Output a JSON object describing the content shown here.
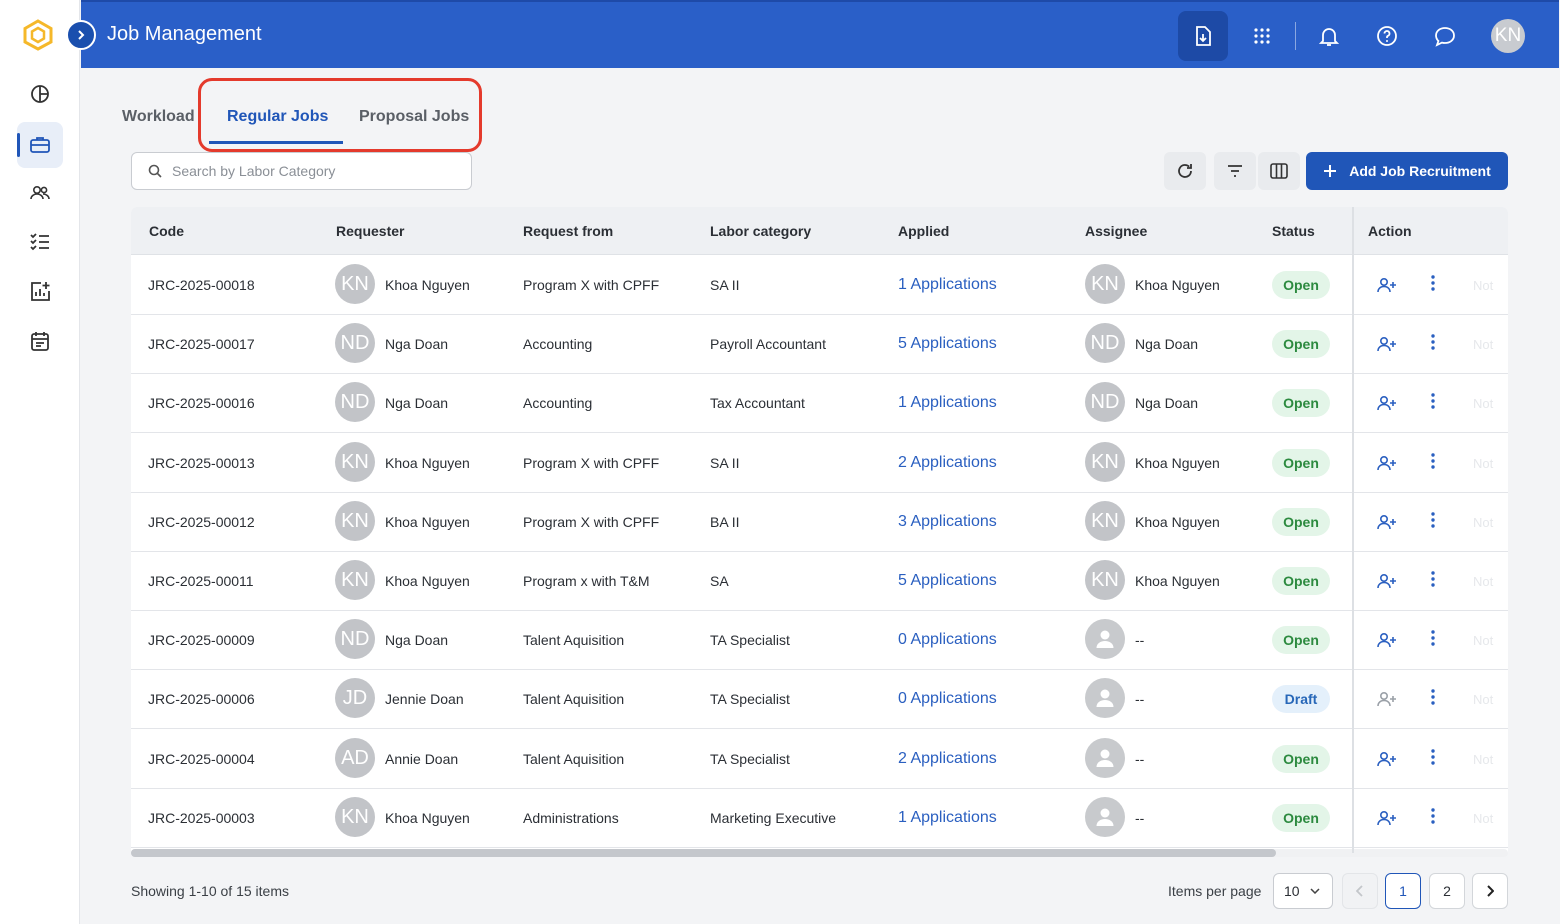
{
  "app": {
    "title": "Job Management",
    "user_initials": "KN"
  },
  "header_icons": [
    "download-doc-icon",
    "apps-grid-icon",
    "bell-icon",
    "help-icon",
    "chat-icon"
  ],
  "sidebar": {
    "items": [
      {
        "name": "dashboard-icon",
        "active": false
      },
      {
        "name": "briefcase-icon",
        "active": true
      },
      {
        "name": "people-icon",
        "active": false
      },
      {
        "name": "checklist-icon",
        "active": false
      },
      {
        "name": "report-add-icon",
        "active": false
      },
      {
        "name": "calendar-icon",
        "active": false
      }
    ]
  },
  "tabs": [
    {
      "label": "Workload"
    },
    {
      "label": "Regular Jobs"
    },
    {
      "label": "Proposal Jobs"
    }
  ],
  "search": {
    "placeholder": "Search by Labor Category"
  },
  "toolbar": {
    "add_label": "Add Job Recruitment"
  },
  "table": {
    "columns": [
      "Code",
      "Requester",
      "Request from",
      "Labor category",
      "Applied",
      "Assignee",
      "Status",
      "Action"
    ],
    "rows": [
      {
        "code": "JRC-2025-00018",
        "req_initials": "KN",
        "requester": "Khoa Nguyen",
        "from": "Program X with CPFF",
        "category": "SA II",
        "applied": "1 Applications",
        "asg_initials": "KN",
        "assignee": "Khoa Nguyen",
        "status": "Open"
      },
      {
        "code": "JRC-2025-00017",
        "req_initials": "ND",
        "requester": "Nga Doan",
        "from": "Accounting",
        "category": "Payroll Accountant",
        "applied": "5 Applications",
        "asg_initials": "ND",
        "assignee": "Nga Doan",
        "status": "Open"
      },
      {
        "code": "JRC-2025-00016",
        "req_initials": "ND",
        "requester": "Nga Doan",
        "from": "Accounting",
        "category": "Tax Accountant",
        "applied": "1 Applications",
        "asg_initials": "ND",
        "assignee": "Nga Doan",
        "status": "Open"
      },
      {
        "code": "JRC-2025-00013",
        "req_initials": "KN",
        "requester": "Khoa Nguyen",
        "from": "Program X with CPFF",
        "category": "SA II",
        "applied": "2 Applications",
        "asg_initials": "KN",
        "assignee": "Khoa Nguyen",
        "status": "Open"
      },
      {
        "code": "JRC-2025-00012",
        "req_initials": "KN",
        "requester": "Khoa Nguyen",
        "from": "Program X with CPFF",
        "category": "BA II",
        "applied": "3 Applications",
        "asg_initials": "KN",
        "assignee": "Khoa Nguyen",
        "status": "Open"
      },
      {
        "code": "JRC-2025-00011",
        "req_initials": "KN",
        "requester": "Khoa Nguyen",
        "from": "Program x with T&M",
        "category": "SA",
        "applied": "5 Applications",
        "asg_initials": "KN",
        "assignee": "Khoa Nguyen",
        "status": "Open"
      },
      {
        "code": "JRC-2025-00009",
        "req_initials": "ND",
        "requester": "Nga Doan",
        "from": "Talent Aquisition",
        "category": "TA Specialist",
        "applied": "0 Applications",
        "asg_initials": "",
        "assignee": "--",
        "status": "Open"
      },
      {
        "code": "JRC-2025-00006",
        "req_initials": "JD",
        "requester": "Jennie Doan",
        "from": "Talent Aquisition",
        "category": "TA Specialist",
        "applied": "0 Applications",
        "asg_initials": "",
        "assignee": "--",
        "status": "Draft"
      },
      {
        "code": "JRC-2025-00004",
        "req_initials": "AD",
        "requester": "Annie Doan",
        "from": "Talent Aquisition",
        "category": "TA Specialist",
        "applied": "2 Applications",
        "asg_initials": "",
        "assignee": "--",
        "status": "Open"
      },
      {
        "code": "JRC-2025-00003",
        "req_initials": "KN",
        "requester": "Khoa Nguyen",
        "from": "Administrations",
        "category": "Marketing Executive",
        "applied": "1 Applications",
        "asg_initials": "",
        "assignee": "--",
        "status": "Open"
      }
    ],
    "ghost_text": "Not"
  },
  "footer": {
    "showing": "Showing 1-10 of 15 items",
    "items_per_page_label": "Items per page",
    "items_per_page": "10",
    "pages": [
      "1",
      "2"
    ],
    "current_page": "1"
  },
  "colors": {
    "primary": "#2056b8",
    "header": "#2a5fc8",
    "open_bg": "#e3f5e8",
    "open_fg": "#2c8a3f",
    "draft_bg": "#e4f0fb",
    "draft_fg": "#2767b8",
    "highlight": "#e43a2c"
  }
}
